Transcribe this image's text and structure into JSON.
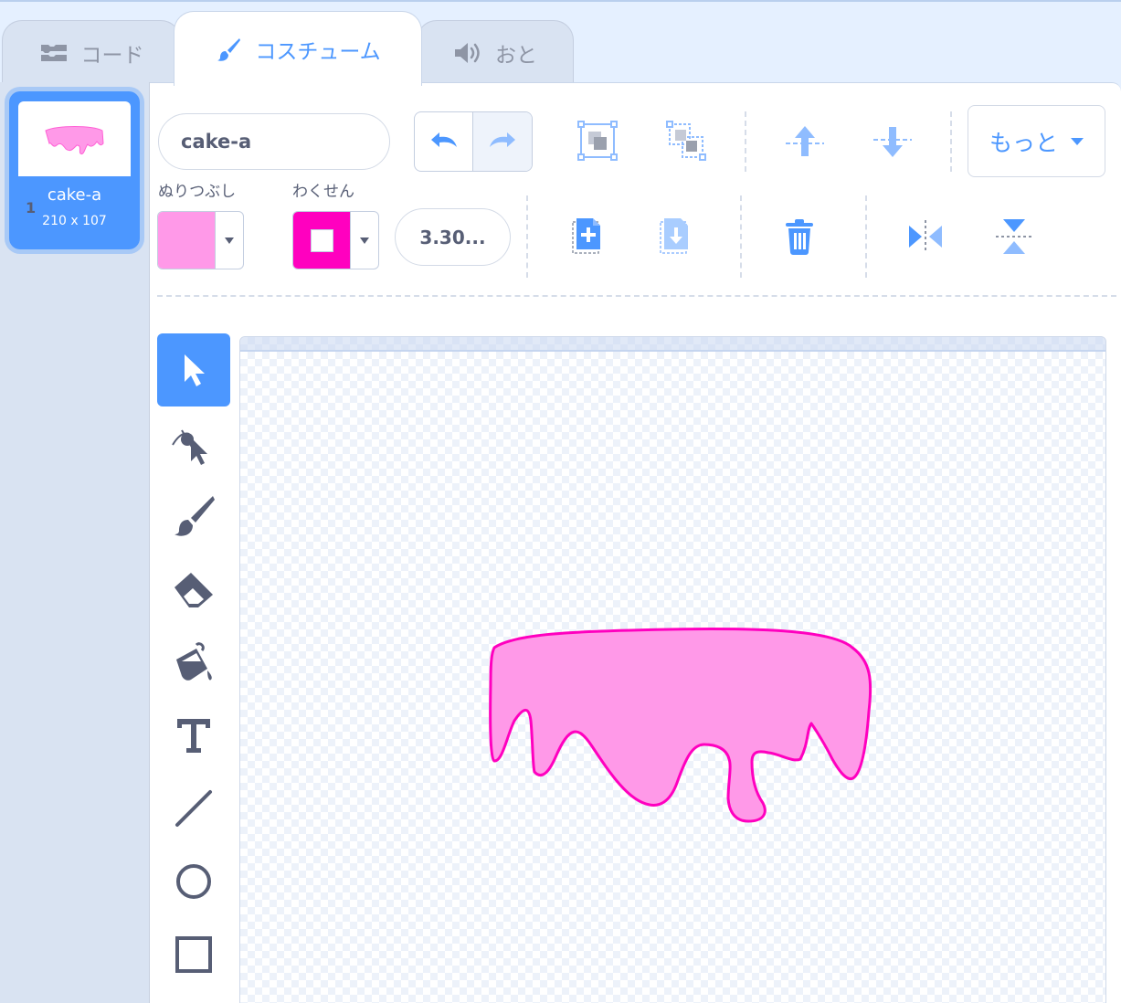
{
  "tabs": {
    "code": "コード",
    "costume": "コスチューム",
    "sound": "おと"
  },
  "costume_list": [
    {
      "number": "1",
      "name": "cake-a",
      "size": "210 x 107"
    }
  ],
  "editor": {
    "costume_name": "cake-a",
    "fill_label": "ぬりつぶし",
    "outline_label": "わくせん",
    "fill_color": "#ff99e8",
    "outline_color": "#ff00bf",
    "outline_width": "3.30...",
    "more_label": "もっと"
  },
  "tools": [
    "select",
    "reshape",
    "brush",
    "eraser",
    "fill",
    "text",
    "line",
    "circle",
    "rectangle"
  ],
  "colors": {
    "accent": "#4c97ff",
    "text": "#575e75",
    "icon_light": "#8fbcff"
  }
}
